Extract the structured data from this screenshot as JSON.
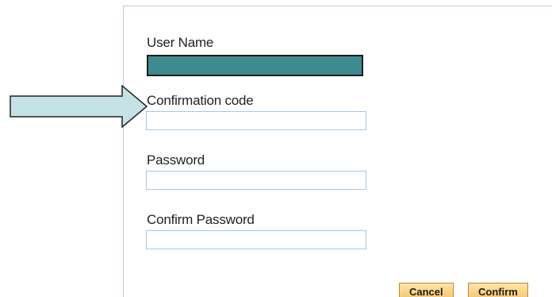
{
  "form": {
    "fields": [
      {
        "label": "User Name",
        "value": "",
        "redacted": true
      },
      {
        "label": "Confirmation code",
        "value": ""
      },
      {
        "label": "Password",
        "value": ""
      },
      {
        "label": "Confirm Password",
        "value": ""
      }
    ],
    "buttons": {
      "cancel": "Cancel",
      "confirm": "Confirm"
    }
  },
  "annotation": {
    "arrow_fill": "#c5e3e6",
    "arrow_points_to": "Confirmation code"
  },
  "colors": {
    "redaction": "#3d8b8f",
    "input_border": "#a9c7e2",
    "button_fill": "#f4c166"
  }
}
